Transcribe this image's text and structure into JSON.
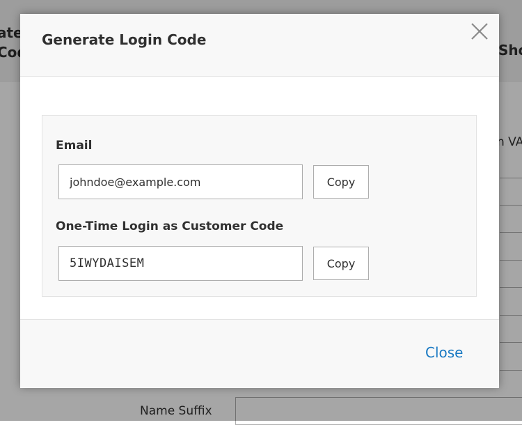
{
  "background": {
    "title_fragment_left": [
      "ate",
      "Cod"
    ],
    "title_fragment_right": "Sho",
    "vat_fragment": "n VAT",
    "name_suffix_label": "Name Suffix"
  },
  "modal": {
    "title": "Generate Login Code",
    "close_icon": "close-icon",
    "email": {
      "label": "Email",
      "value": "johndoe@example.com",
      "copy_label": "Copy"
    },
    "login_code": {
      "label": "One-Time Login as Customer Code",
      "value": "5IWYDAISEM",
      "copy_label": "Copy"
    },
    "footer": {
      "close_label": "Close"
    }
  },
  "colors": {
    "accent_link": "#1979c3",
    "text": "#303030",
    "border": "#adadad",
    "panel_bg": "#f8f8f8"
  }
}
